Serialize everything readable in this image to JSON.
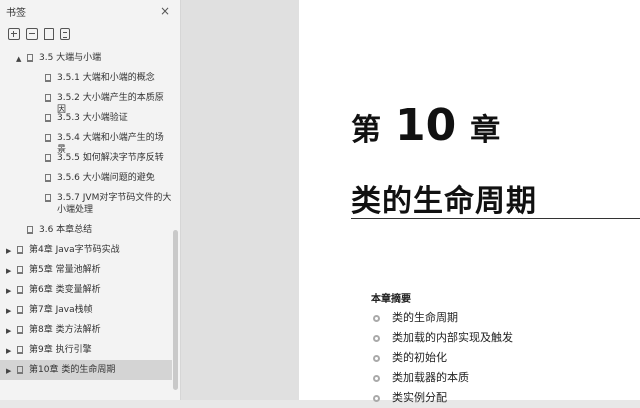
{
  "sidebar": {
    "title": "书签",
    "close": "×",
    "items": [
      {
        "label": "3.5 大端与小端",
        "level": 0,
        "expanded": true,
        "arrow": "▲"
      },
      {
        "label": "3.5.1 大端和小端的概念",
        "level": 1
      },
      {
        "label": "3.5.2 大小端产生的本质原因",
        "level": 1
      },
      {
        "label": "3.5.3 大小端验证",
        "level": 1
      },
      {
        "label": "3.5.4 大端和小端产生的场景",
        "level": 1
      },
      {
        "label": "3.5.5 如何解决字节序反转",
        "level": 1
      },
      {
        "label": "3.5.6 大小端问题的避免",
        "level": 1
      },
      {
        "label": "3.5.7 JVM对字节码文件的大小端处理",
        "level": 1
      },
      {
        "label": "3.6 本章总结",
        "level": 0
      },
      {
        "label": "第4章 Java字节码实战",
        "level": -1,
        "arrow": "▶"
      },
      {
        "label": "第5章 常量池解析",
        "level": -1,
        "arrow": "▶"
      },
      {
        "label": "第6章 类变量解析",
        "level": -1,
        "arrow": "▶"
      },
      {
        "label": "第7章 Java栈帧",
        "level": -1,
        "arrow": "▶"
      },
      {
        "label": "第8章 类方法解析",
        "level": -1,
        "arrow": "▶"
      },
      {
        "label": "第9章 执行引擎",
        "level": -1,
        "arrow": "▶"
      },
      {
        "label": "第10章 类的生命周期",
        "level": -1,
        "arrow": "▶",
        "selected": true
      }
    ]
  },
  "page": {
    "chapter_prefix": "第",
    "chapter_number": "10",
    "chapter_suffix": "章",
    "title": "类的生命周期",
    "summary_heading": "本章摘要",
    "summary_items": [
      "类的生命周期",
      "类加载的内部实现及触发",
      "类的初始化",
      "类加载器的本质",
      "类实例分配"
    ]
  }
}
